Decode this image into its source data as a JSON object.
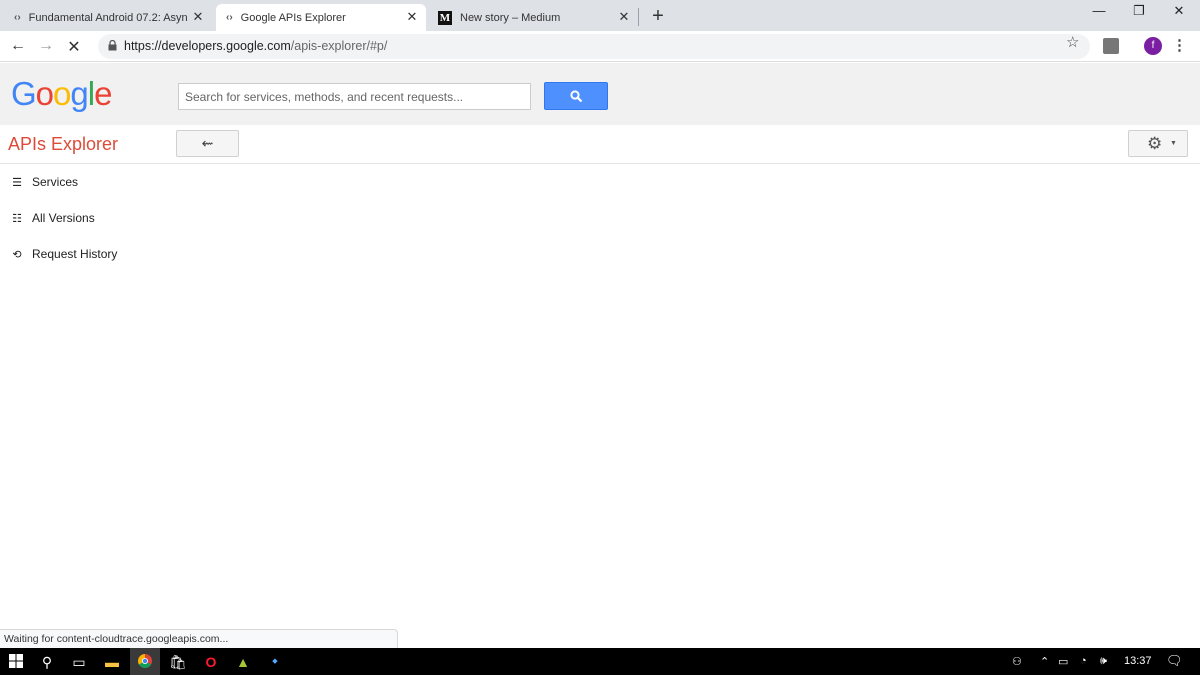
{
  "browser": {
    "tabs": [
      {
        "title": "Fundamental Android 07.2: Asyn",
        "favicon": "code-icon"
      },
      {
        "title": "Google APIs Explorer",
        "favicon": "code-icon",
        "active": true
      },
      {
        "title": "New story – Medium",
        "favicon": "medium-icon"
      }
    ],
    "new_tab_label": "+",
    "window_controls": {
      "minimize": "—",
      "restore": "❐",
      "close": "✕"
    },
    "url_host": "https://developers.google.com",
    "url_path": "/apis-explorer/#p/",
    "profile_initial": "f",
    "status_text": "Waiting for content-cloudtrace.googleapis.com..."
  },
  "header": {
    "logo_letters": [
      {
        "ch": "G",
        "color": "#4285f4"
      },
      {
        "ch": "o",
        "color": "#ea4335"
      },
      {
        "ch": "o",
        "color": "#fbbc05"
      },
      {
        "ch": "g",
        "color": "#4285f4"
      },
      {
        "ch": "l",
        "color": "#34a853"
      },
      {
        "ch": "e",
        "color": "#ea4335"
      }
    ],
    "search_placeholder": "Search for services, methods, and recent requests..."
  },
  "subheader": {
    "title": "APIs Explorer",
    "back_label": "⇜"
  },
  "sidebar": {
    "items": [
      {
        "label": "Services",
        "icon": "list-icon"
      },
      {
        "label": "All Versions",
        "icon": "versions-icon"
      },
      {
        "label": "Request History",
        "icon": "history-icon"
      }
    ]
  },
  "taskbar": {
    "clock": "13:37"
  },
  "colors": {
    "title_red": "#dd4b39",
    "search_blue": "#4d90fe"
  }
}
